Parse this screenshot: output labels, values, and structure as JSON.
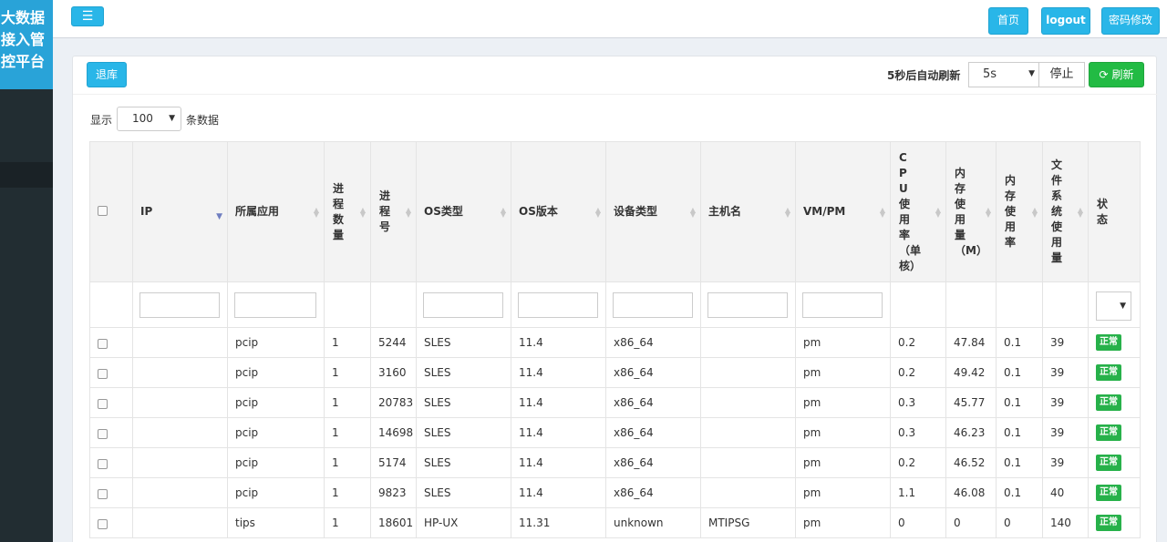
{
  "app": {
    "brand_lines": [
      "大数据",
      "接入管",
      "控平台"
    ]
  },
  "topbar": {
    "menu_icon": "menu-icon",
    "home": "首页",
    "logout": "logout",
    "change_password": "密码修改"
  },
  "toolbar": {
    "out_lib": "退库",
    "auto_refresh_label": "5秒后自动刷新",
    "interval_value": "5s",
    "stop": "停止",
    "refresh": "刷新",
    "refresh_icon": "refresh-icon"
  },
  "length_menu": {
    "prefix": "显示",
    "value": "100",
    "suffix": "条数据"
  },
  "table": {
    "columns": [
      {
        "key": "ip",
        "label": "IP"
      },
      {
        "key": "app",
        "label": "所属应用"
      },
      {
        "key": "proc_count",
        "label": "进程数量"
      },
      {
        "key": "pid",
        "label": "进程号"
      },
      {
        "key": "os_type",
        "label": "OS类型"
      },
      {
        "key": "os_ver",
        "label": "OS版本"
      },
      {
        "key": "device",
        "label": "设备类型"
      },
      {
        "key": "host",
        "label": "主机名"
      },
      {
        "key": "vmpm",
        "label": "VM/PM"
      },
      {
        "key": "cpu",
        "label": "CPU使用率（单核）"
      },
      {
        "key": "mem",
        "label": "内存使用量（M）"
      },
      {
        "key": "mem_rate",
        "label": "内存使用率"
      },
      {
        "key": "fs",
        "label": "文件系统使用量"
      },
      {
        "key": "status",
        "label": "状态"
      }
    ],
    "rows": [
      {
        "ip": "",
        "app": "pcip",
        "proc_count": "1",
        "pid": "5244",
        "os_type": "SLES",
        "os_ver": "11.4",
        "device": "x86_64",
        "host": "",
        "vmpm": "pm",
        "cpu": "0.2",
        "mem": "47.84",
        "mem_rate": "0.1",
        "fs": "39",
        "status": "正常"
      },
      {
        "ip": "",
        "app": "pcip",
        "proc_count": "1",
        "pid": "3160",
        "os_type": "SLES",
        "os_ver": "11.4",
        "device": "x86_64",
        "host": "",
        "vmpm": "pm",
        "cpu": "0.2",
        "mem": "49.42",
        "mem_rate": "0.1",
        "fs": "39",
        "status": "正常"
      },
      {
        "ip": "",
        "app": "pcip",
        "proc_count": "1",
        "pid": "20783",
        "os_type": "SLES",
        "os_ver": "11.4",
        "device": "x86_64",
        "host": "",
        "vmpm": "pm",
        "cpu": "0.3",
        "mem": "45.77",
        "mem_rate": "0.1",
        "fs": "39",
        "status": "正常"
      },
      {
        "ip": "",
        "app": "pcip",
        "proc_count": "1",
        "pid": "14698",
        "os_type": "SLES",
        "os_ver": "11.4",
        "device": "x86_64",
        "host": "",
        "vmpm": "pm",
        "cpu": "0.3",
        "mem": "46.23",
        "mem_rate": "0.1",
        "fs": "39",
        "status": "正常"
      },
      {
        "ip": "",
        "app": "pcip",
        "proc_count": "1",
        "pid": "5174",
        "os_type": "SLES",
        "os_ver": "11.4",
        "device": "x86_64",
        "host": "",
        "vmpm": "pm",
        "cpu": "0.2",
        "mem": "46.52",
        "mem_rate": "0.1",
        "fs": "39",
        "status": "正常"
      },
      {
        "ip": "",
        "app": "pcip",
        "proc_count": "1",
        "pid": "9823",
        "os_type": "SLES",
        "os_ver": "11.4",
        "device": "x86_64",
        "host": "",
        "vmpm": "pm",
        "cpu": "1.1",
        "mem": "46.08",
        "mem_rate": "0.1",
        "fs": "40",
        "status": "正常"
      },
      {
        "ip": "",
        "app": "tips",
        "proc_count": "1",
        "pid": "18601",
        "os_type": "HP-UX",
        "os_ver": "11.31",
        "device": "unknown",
        "host": "MTIPSG",
        "vmpm": "pm",
        "cpu": "0",
        "mem": "0",
        "mem_rate": "0",
        "fs": "140",
        "status": "正常"
      }
    ]
  },
  "colors": {
    "brand_bg": "#29a3d8",
    "sidebar_bg": "#222d32",
    "primary_button": "#29b6e8",
    "success_button": "#22bb44",
    "status_ok": "#27b14a"
  }
}
